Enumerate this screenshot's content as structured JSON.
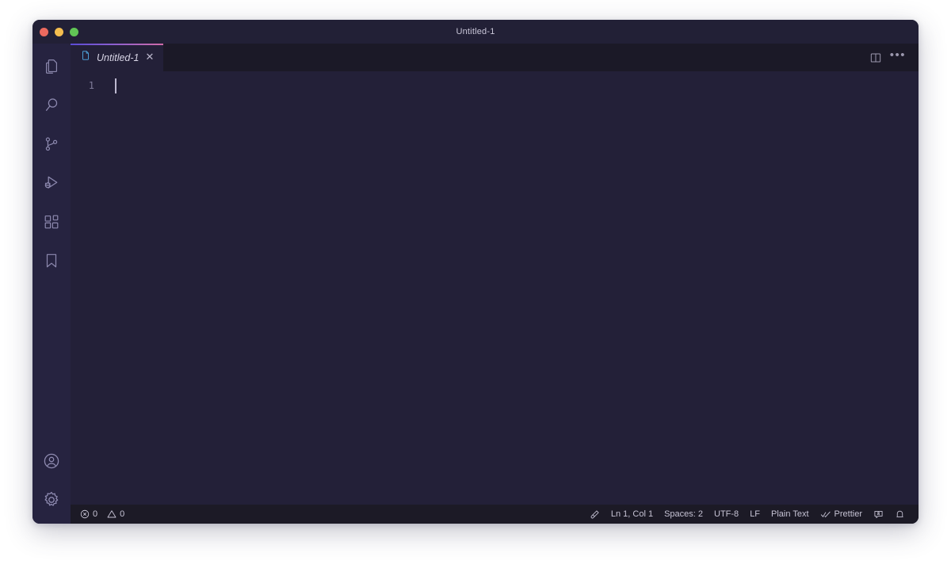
{
  "window": {
    "title": "Untitled-1",
    "traffic_lights": [
      {
        "name": "close-button",
        "color": "#EC6A5F"
      },
      {
        "name": "minimize-button",
        "color": "#F4BE4F"
      },
      {
        "name": "maximize-button",
        "color": "#61C555"
      }
    ]
  },
  "activity_bar": {
    "items": [
      {
        "id": "explorer",
        "icon": "files-icon",
        "label": "Explorer"
      },
      {
        "id": "search",
        "icon": "search-icon",
        "label": "Search"
      },
      {
        "id": "source-control",
        "icon": "source-control-icon",
        "label": "Source Control"
      },
      {
        "id": "run-debug",
        "icon": "run-and-debug-icon",
        "label": "Run and Debug"
      },
      {
        "id": "extensions",
        "icon": "extensions-icon",
        "label": "Extensions"
      },
      {
        "id": "bookmarks",
        "icon": "bookmark-icon",
        "label": "Bookmarks"
      }
    ],
    "bottom_items": [
      {
        "id": "accounts",
        "icon": "account-icon",
        "label": "Accounts"
      },
      {
        "id": "settings",
        "icon": "gear-icon",
        "label": "Manage"
      }
    ]
  },
  "tabs": [
    {
      "label": "Untitled-1",
      "icon": "file-icon",
      "close_label": "✕",
      "active": true,
      "italic": true
    }
  ],
  "tabbar_actions": [
    {
      "id": "split-editor",
      "icon": "split-editor-icon",
      "label": "Split Editor"
    },
    {
      "id": "more-actions",
      "icon": "more-actions-icon",
      "label": "•••"
    }
  ],
  "editor": {
    "line_numbers": [
      "1"
    ],
    "content": "",
    "cursor_visible": true
  },
  "status_bar": {
    "left": [
      {
        "id": "errors",
        "icon": "error-icon",
        "text": "0"
      },
      {
        "id": "warnings",
        "icon": "warning-icon",
        "text": "0"
      }
    ],
    "right": [
      {
        "id": "ink-drop",
        "icon": "ink-drop-icon",
        "text": ""
      },
      {
        "id": "cursor-position",
        "icon": "",
        "text": "Ln 1, Col 1"
      },
      {
        "id": "indentation",
        "icon": "",
        "text": "Spaces: 2"
      },
      {
        "id": "encoding",
        "icon": "",
        "text": "UTF-8"
      },
      {
        "id": "eol",
        "icon": "",
        "text": "LF"
      },
      {
        "id": "language-mode",
        "icon": "",
        "text": "Plain Text"
      },
      {
        "id": "prettier",
        "icon": "double-check-icon",
        "text": "Prettier"
      },
      {
        "id": "feedback",
        "icon": "feedback-icon",
        "text": ""
      },
      {
        "id": "notifications",
        "icon": "bell-icon",
        "text": ""
      }
    ]
  },
  "colors": {
    "editor_background": "#232038",
    "activity_bar_background": "#262340",
    "tab_bar_background": "#1b1927",
    "status_bar_background": "#1c1a26",
    "title_bar_background": "#222036",
    "tab_active_border_start": "#5b4bd6",
    "tab_active_border_end": "#d06ba8",
    "icon_foreground": "#8e8ab0",
    "text_foreground": "#c6c3d4"
  }
}
